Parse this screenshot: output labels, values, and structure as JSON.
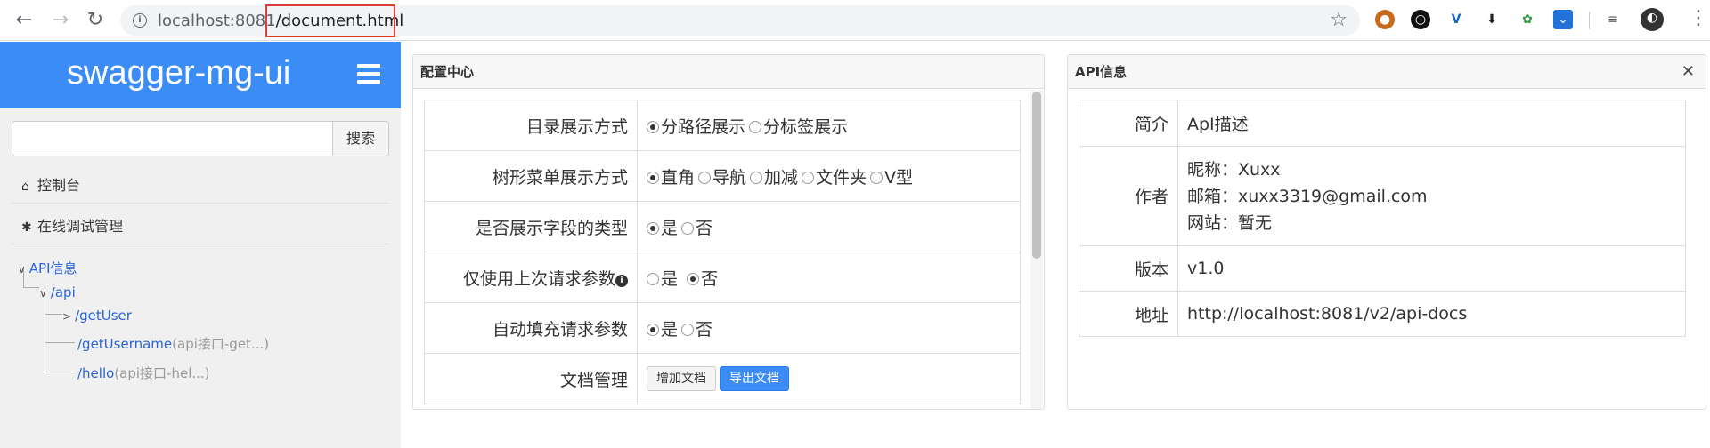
{
  "browser": {
    "url_host": "localhost:8081",
    "url_path": "/document.html"
  },
  "sidebar": {
    "brand": "swagger-mg-ui",
    "search_button": "搜索",
    "search_placeholder": "",
    "menu": [
      {
        "label": "控制台"
      },
      {
        "label": "在线调试管理"
      }
    ],
    "tree": {
      "root": "API信息",
      "group": "/api",
      "items": [
        {
          "path": "/getUser",
          "desc": ""
        },
        {
          "path": "/getUsername",
          "desc": "(api接口-get...)"
        },
        {
          "path": "/hello",
          "desc": "(api接口-hel...)"
        }
      ]
    }
  },
  "config_panel": {
    "title": "配置中心",
    "rows": [
      {
        "label": "目录展示方式",
        "options": [
          {
            "text": "分路径展示",
            "checked": true
          },
          {
            "text": "分标签展示",
            "checked": false
          }
        ]
      },
      {
        "label": "树形菜单展示方式",
        "options": [
          {
            "text": "直角",
            "checked": true
          },
          {
            "text": "导航",
            "checked": false
          },
          {
            "text": "加减",
            "checked": false
          },
          {
            "text": "文件夹",
            "checked": false
          },
          {
            "text": "V型",
            "checked": false
          }
        ]
      },
      {
        "label": "是否展示字段的类型",
        "options": [
          {
            "text": "是",
            "checked": true
          },
          {
            "text": "否",
            "checked": false
          }
        ]
      },
      {
        "label": "仅使用上次请求参数",
        "options": [
          {
            "text": "是",
            "checked": false
          },
          {
            "text": "否",
            "checked": true
          }
        ]
      },
      {
        "label": "自动填充请求参数",
        "options": [
          {
            "text": "是",
            "checked": true
          },
          {
            "text": "否",
            "checked": false
          }
        ]
      }
    ],
    "doc_row": {
      "label": "文档管理",
      "add_button": "增加文档",
      "export_button": "导出文档"
    }
  },
  "api_panel": {
    "title": "API信息",
    "rows": {
      "intro_label": "简介",
      "intro_value": "ApI描述",
      "author_label": "作者",
      "author_name": "昵称：Xuxx",
      "author_email": "邮箱：xuxx3319@gmail.com",
      "author_site": "网站：暂无",
      "version_label": "版本",
      "version_value": "v1.0",
      "address_label": "地址",
      "address_value": "http://localhost:8081/v2/api-docs"
    }
  },
  "colors": {
    "brand": "#3b8cf4",
    "link": "#2a64d6",
    "highlight_border": "#e53935"
  }
}
